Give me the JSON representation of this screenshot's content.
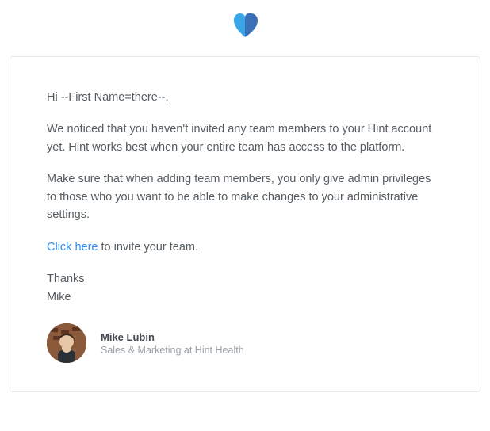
{
  "logo": {
    "name": "hint-heart-logo"
  },
  "email": {
    "greeting": "Hi --First Name=there--,",
    "para1": "We noticed that you haven't invited any team members to your Hint account yet. Hint works best when your entire team has access to the platform.",
    "para2": "Make sure that when adding team members, you only give admin privileges to those who you want to be able to make changes to your administrative settings.",
    "cta_link_text": "Click here",
    "cta_rest": " to invite your team.",
    "thanks": "Thanks",
    "signoff_name": "Mike"
  },
  "signature": {
    "name": "Mike Lubin",
    "role": "Sales & Marketing at Hint Health"
  }
}
